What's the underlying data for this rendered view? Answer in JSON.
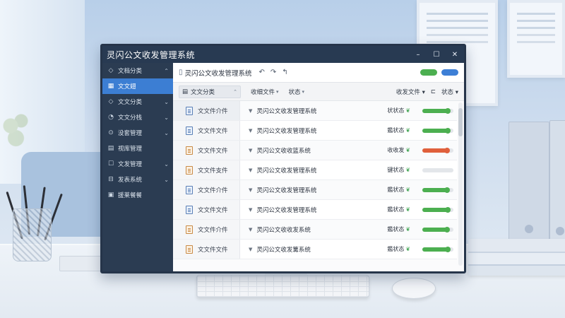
{
  "app": {
    "title": "灵闪公文收发管理系统"
  },
  "window_controls": {
    "minimize": "–",
    "maximize": "☐",
    "close": "✕"
  },
  "sidebar": {
    "items": [
      {
        "label": "文档分类",
        "icon": "◇",
        "chevron": "⌃",
        "active": false
      },
      {
        "label": "文文翅",
        "icon": "▦",
        "chevron": "",
        "active": true
      },
      {
        "label": "文文分类",
        "icon": "◇",
        "chevron": "⌄",
        "active": false
      },
      {
        "label": "文文分栈",
        "icon": "◔",
        "chevron": "⌄",
        "active": false
      },
      {
        "label": "没套管理",
        "icon": "⊙",
        "chevron": "⌄",
        "active": false
      },
      {
        "label": "视库管理",
        "icon": "▤",
        "chevron": "",
        "active": false
      },
      {
        "label": "文发管理",
        "icon": "☐",
        "chevron": "⌄",
        "active": false
      },
      {
        "label": "发表系统",
        "icon": "⊟",
        "chevron": "⌄",
        "active": false
      },
      {
        "label": "援莱餐餐",
        "icon": "▣",
        "chevron": "",
        "active": false
      }
    ]
  },
  "toolbar": {
    "title": "灵闪公文收发管理系统",
    "undo": "↶",
    "redo": "↷",
    "history": "↰",
    "pill_colors": [
      "#4caf50",
      "#3d7fd6"
    ]
  },
  "list_header": {
    "category": "文文分类",
    "col_received": "收细文件",
    "col_status": "状态",
    "right_received": "收发文件",
    "right_status": "状态"
  },
  "rows": [
    {
      "category": "文文件介件",
      "icon_color": "blue",
      "subject": "灵闪公文收发管理系统",
      "status": "状状态",
      "fill": 0.8,
      "bar_color": "#4caf50"
    },
    {
      "category": "文文件文件",
      "icon_color": "blue",
      "subject": "灵闪公文收发管理系统",
      "status": "鑑状态",
      "fill": 0.82,
      "bar_color": "#4caf50"
    },
    {
      "category": "文文件文件",
      "icon_color": "orange",
      "subject": "灵闪公文收收篮系统",
      "status": "收收发",
      "fill": 0.78,
      "bar_color": "#e0603c"
    },
    {
      "category": "文文件支件",
      "icon_color": "orange",
      "subject": "灵闪公文收发管理系统",
      "status": "键状态",
      "fill": 0.0,
      "bar_color": "#c8ccd2"
    },
    {
      "category": "文文件介件",
      "icon_color": "blue",
      "subject": "灵闪公文收发管理系统",
      "status": "鑑状态",
      "fill": 0.78,
      "bar_color": "#4caf50"
    },
    {
      "category": "文文件文件",
      "icon_color": "blue",
      "subject": "灵闪公文收发管理系统",
      "status": "鑑状态",
      "fill": 0.8,
      "bar_color": "#4caf50"
    },
    {
      "category": "文文件介件",
      "icon_color": "orange",
      "subject": "灵闪公文收收发系统",
      "status": "鑑状态",
      "fill": 0.78,
      "bar_color": "#4caf50"
    },
    {
      "category": "文文件文件",
      "icon_color": "orange",
      "subject": "灵闪公文收发篝系统",
      "status": "鑑状态",
      "fill": 0.8,
      "bar_color": "#4caf50"
    }
  ]
}
